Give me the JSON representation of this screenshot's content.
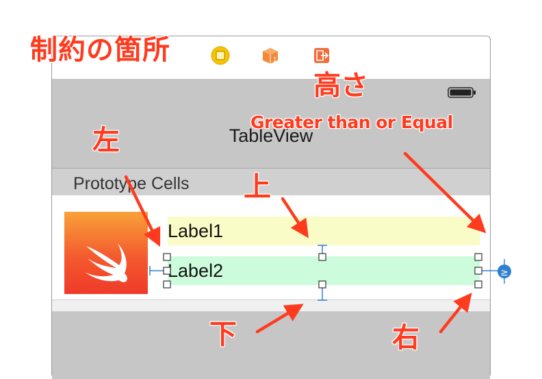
{
  "annotations": {
    "title": "制約の箇所",
    "height": "高さ",
    "greater_or_equal": "Greater than or Equal",
    "left": "左",
    "top": "上",
    "bottom": "下",
    "right": "右"
  },
  "scene": {
    "dock_icons": [
      "view-controller-icon",
      "first-responder-cube-icon",
      "exit-icon"
    ],
    "cube_badge": "1",
    "nav_title": "TableView",
    "section_title": "Prototype Cells",
    "cell": {
      "image": "swift-logo-icon",
      "label1": "Label1",
      "label2": "Label2"
    },
    "relation_badge": "≥"
  },
  "colors": {
    "annotation_red": "#ff3b1f",
    "constraint_blue": "#2f7fd0",
    "label1_bg": "#fafcc8",
    "label2_bg": "#ccfcdc"
  }
}
